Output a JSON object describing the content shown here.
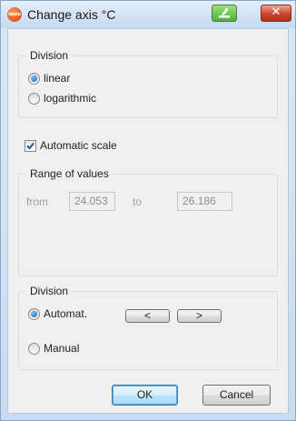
{
  "window": {
    "title": "Change axis °C",
    "logo_text": "testo",
    "close_glyph": "✕"
  },
  "division_scale": {
    "legend": "Division",
    "options": [
      {
        "label": "linear",
        "checked": true
      },
      {
        "label": "logarithmic",
        "checked": false
      }
    ]
  },
  "automatic_scale": {
    "label": "Automatic scale",
    "checked": true
  },
  "range": {
    "legend": "Range of values",
    "from_label": "from",
    "from_value": "24.053",
    "to_label": "to",
    "to_value": "26.186",
    "disabled": true
  },
  "division_ticks": {
    "legend": "Division",
    "automat_label": "Automat.",
    "manual_label": "Manual",
    "automat_checked": true,
    "prev_label": "<",
    "next_label": ">"
  },
  "buttons": {
    "ok": "OK",
    "cancel": "Cancel"
  },
  "colors": {
    "close_button": "#c8452e",
    "restore_button": "#4fb13a",
    "default_button_border": "#3c7fb1"
  }
}
